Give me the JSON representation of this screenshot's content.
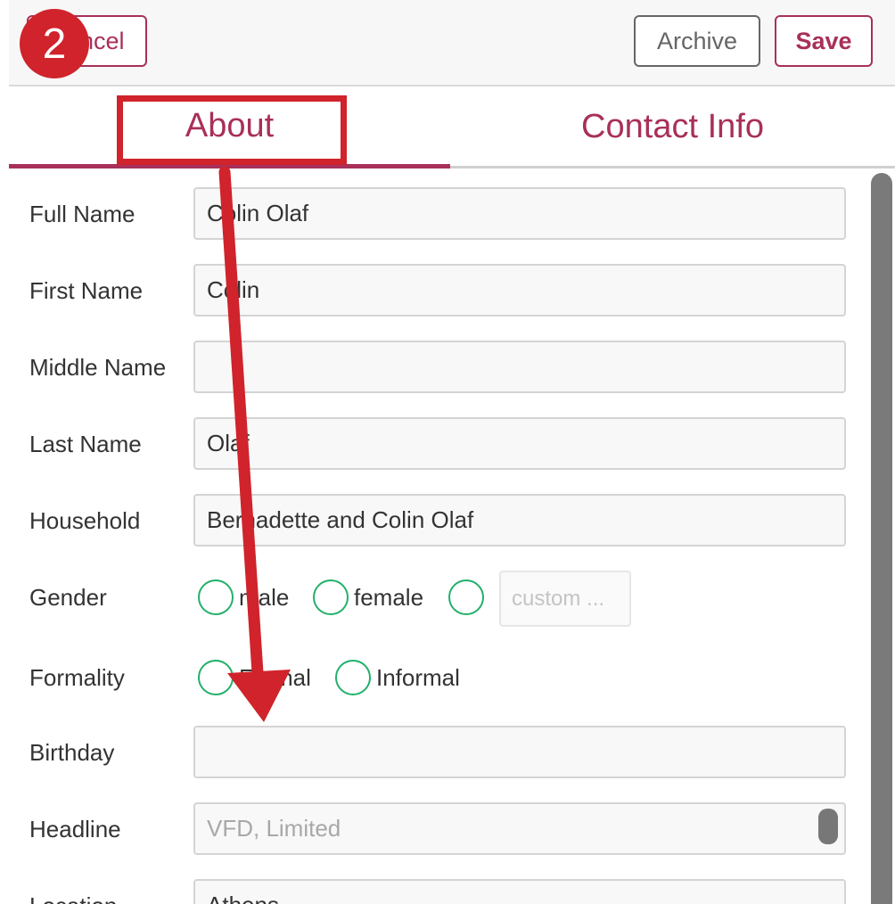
{
  "toolbar": {
    "cancel_label": "Cancel",
    "archive_label": "Archive",
    "save_label": "Save"
  },
  "step_badge": "2",
  "tabs": [
    {
      "label": "About",
      "active": true
    },
    {
      "label": "Contact Info",
      "active": false
    }
  ],
  "form": {
    "full_name": {
      "label": "Full Name",
      "value": "Colin Olaf"
    },
    "first_name": {
      "label": "First Name",
      "value": "Colin"
    },
    "middle_name": {
      "label": "Middle Name",
      "value": ""
    },
    "last_name": {
      "label": "Last Name",
      "value": "Olaf"
    },
    "household": {
      "label": "Household",
      "value": "Bernadette and Colin Olaf"
    },
    "gender": {
      "label": "Gender",
      "options": [
        "male",
        "female"
      ],
      "custom_placeholder": "custom ..."
    },
    "formality": {
      "label": "Formality",
      "options": [
        "Formal",
        "Informal"
      ]
    },
    "birthday": {
      "label": "Birthday",
      "value": ""
    },
    "headline": {
      "label": "Headline",
      "placeholder": "VFD, Limited"
    },
    "location": {
      "label": "Location",
      "value": "Athens"
    }
  },
  "colors": {
    "accent": "#a8305a",
    "annotation_red": "#d0232b",
    "radio_green": "#22b06a"
  }
}
